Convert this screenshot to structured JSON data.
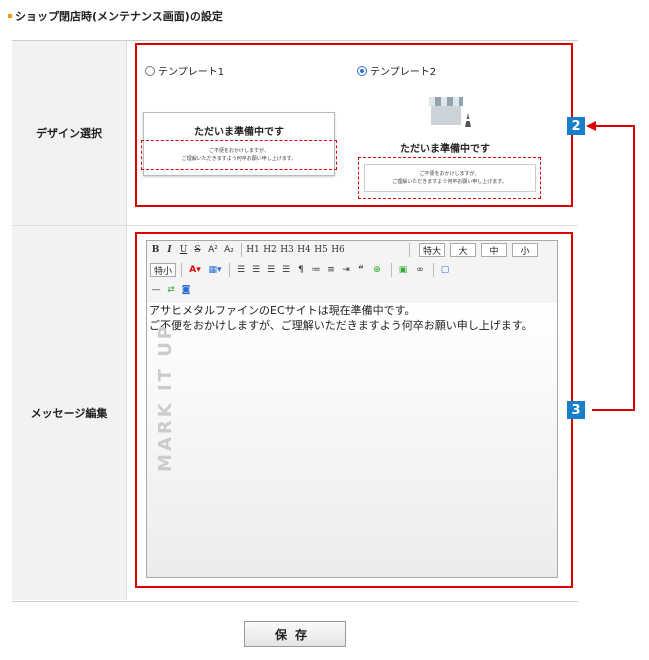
{
  "section": {
    "title": "ショップ閉店時(メンテナンス画面)の設定"
  },
  "design": {
    "label": "デザイン選択",
    "option1": "テンプレート1",
    "option2": "テンプレート2",
    "selected": "テンプレート2",
    "preview_heading": "ただいま準備中です",
    "preview_line1": "ご不便をおかけしますが、",
    "preview_line2": "ご理解いただきますよう何卒お願い申し上げます。",
    "preview2_line1": "ご不便をおかけしますが、",
    "preview2_line2": "ご理解いただきますよう何卒お願い申し上げます。"
  },
  "message": {
    "label": "メッセージ編集",
    "line1": "アサヒメタルファインのECサイトは現在準備中です。",
    "line2": "ご不便をおかけしますが、ご理解いただきますよう何卒お願い申し上げます。",
    "watermark": "MARK IT UP"
  },
  "toolbar": {
    "bold": "B",
    "italic": "I",
    "underline": "U",
    "strike": "S",
    "sup": "A²",
    "sub": "A₂",
    "h1": "H1",
    "h2": "H2",
    "h3": "H3",
    "h4": "H4",
    "h5": "H5",
    "h6": "H6",
    "size_xl": "特大",
    "size_l": "大",
    "size_m": "中",
    "size_s": "小",
    "size_xs": "特小"
  },
  "badges": {
    "b2": "2",
    "b3": "3"
  },
  "save_label": "保存",
  "colors": {
    "accent": "#f39800",
    "highlight": "#dd0000",
    "badge": "#1a7fc9"
  }
}
